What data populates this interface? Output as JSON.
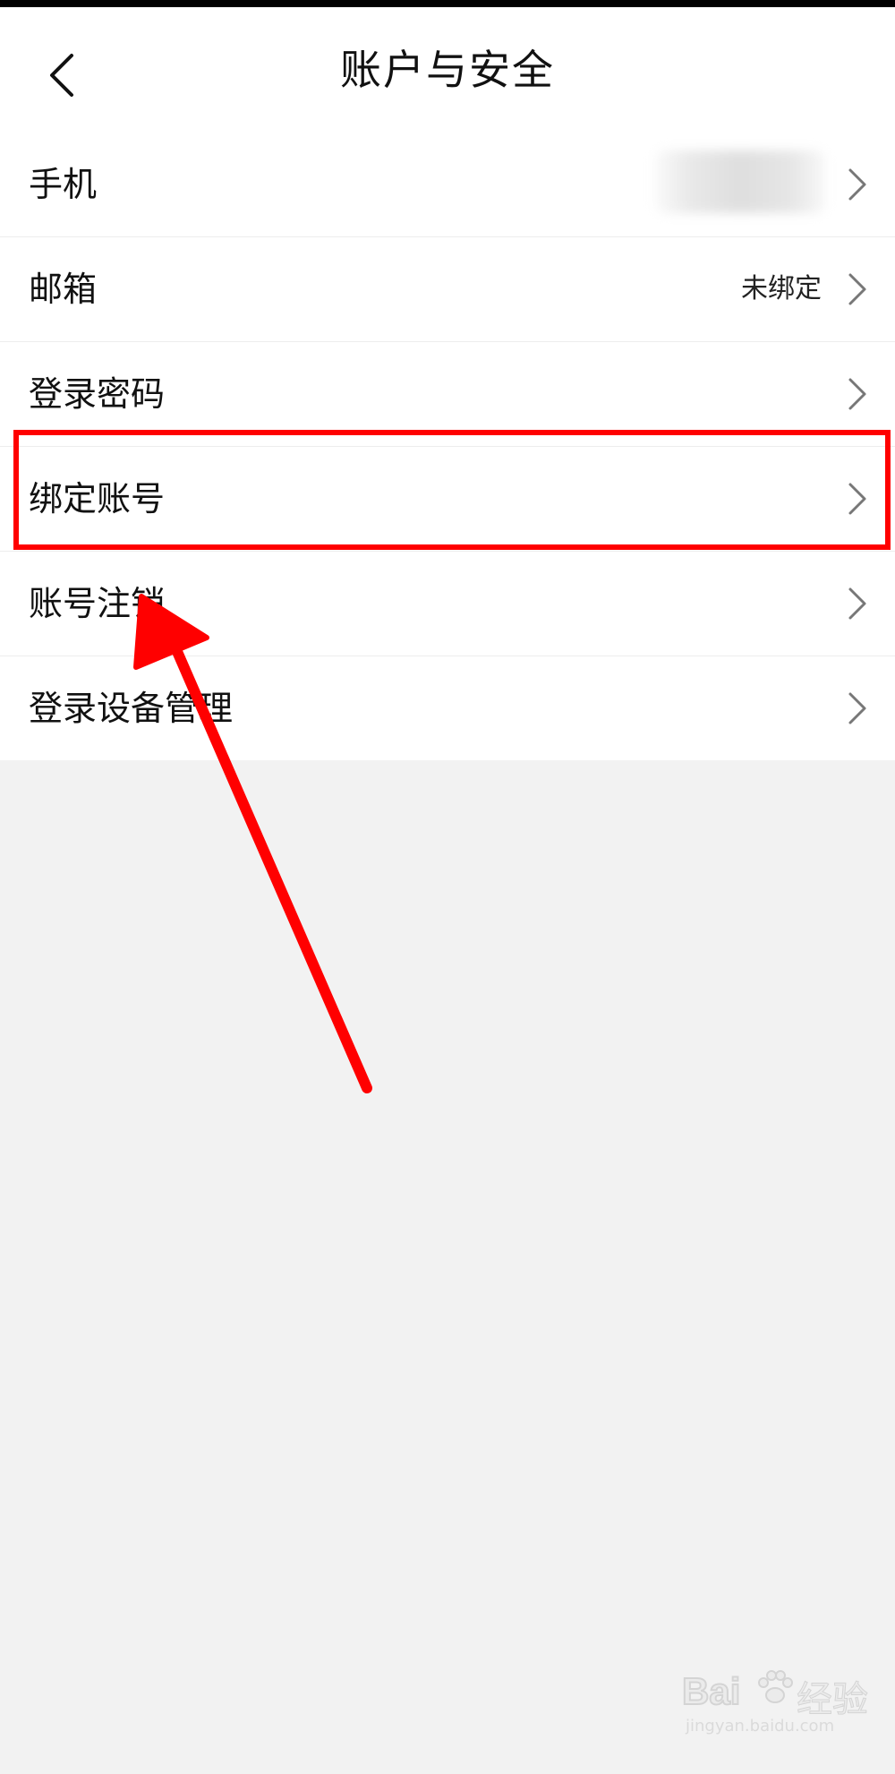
{
  "header": {
    "title": "账户与安全",
    "back_icon": "chevron-left-icon"
  },
  "settings": {
    "items": [
      {
        "label": "手机",
        "value": "",
        "value_blurred": true
      },
      {
        "label": "邮箱",
        "value": "未绑定"
      },
      {
        "label": "登录密码",
        "value": ""
      },
      {
        "label": "绑定账号",
        "value": "",
        "highlighted": true
      },
      {
        "label": "账号注销",
        "value": ""
      },
      {
        "label": "登录设备管理",
        "value": ""
      }
    ]
  },
  "annotation": {
    "highlight_color": "#ff0000",
    "arrow_color": "#ff0000"
  },
  "watermark": {
    "brand": "Bai",
    "brand_cn": "经验",
    "url": "jingyan.baidu.com"
  }
}
